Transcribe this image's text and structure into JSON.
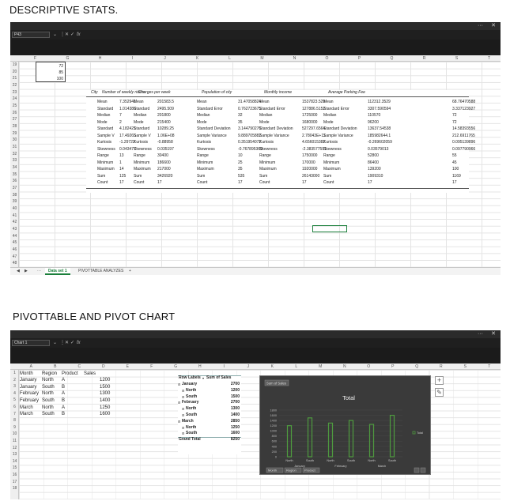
{
  "headings": {
    "top": "DESCRIPTIVE STATS.",
    "bottom": "PIVOTTABLE AND PIVOT CHART"
  },
  "window1": {
    "namebox": "P43",
    "fx": "fx",
    "columns": [
      "F",
      "G",
      "H",
      "I",
      "J",
      "K",
      "L",
      "M",
      "N",
      "O",
      "P",
      "Q",
      "R",
      "S",
      "T"
    ],
    "rows": [
      "19",
      "20",
      "21",
      "22",
      "23",
      "24",
      "25",
      "26",
      "27",
      "28",
      "29",
      "30",
      "31",
      "32",
      "33",
      "34",
      "35",
      "36",
      "37",
      "38",
      "39",
      "40",
      "41",
      "42",
      "43",
      "44",
      "45",
      "46",
      "47",
      "48"
    ],
    "top_values": [
      "72",
      "85",
      "100"
    ],
    "groups": [
      {
        "header": "City",
        "labels": [],
        "values": []
      },
      {
        "header": "Number of weekly riders",
        "labels": [
          "Mean",
          "Standard",
          "Median",
          "Mode",
          "Standard",
          "Sample V",
          "Kurtosis",
          "Skewness",
          "Range",
          "Minimum",
          "Maximum",
          "Sum",
          "Count"
        ],
        "values": [
          "7.352941",
          "1.014386",
          "7",
          "2",
          "4.182421",
          "17.49265",
          "-1.29722",
          "0.043477",
          "13",
          "1",
          "14",
          "125",
          "17"
        ]
      },
      {
        "header": "Charges per week",
        "labels": [
          "Mean",
          "Standard",
          "Median",
          "Mode",
          "Standard",
          "Sample V",
          "Kurtosis",
          "Skewness",
          "Range",
          "Minimum",
          "Maximum",
          "Sum",
          "Count"
        ],
        "values": [
          "201583.5",
          "2495.509",
          "201800",
          "215400",
          "10289.25",
          "1.06E+08",
          "-0.88958",
          "0.035197",
          "30400",
          "186600",
          "217000",
          "3426920",
          "17"
        ]
      },
      {
        "header": "Population of city",
        "labels": [
          "Mean",
          "Standard Error",
          "Median",
          "Mode",
          "Standard Deviation",
          "Sample Variance",
          "Kurtosis",
          "Skewness",
          "Range",
          "Minimum",
          "Maximum",
          "Sum",
          "Count"
        ],
        "values": [
          "31.47058824",
          "0.762723675",
          "32",
          "35",
          "3.144790276",
          "9.889705882",
          "0.351954072",
          "-0.767895369",
          "10",
          "25",
          "35",
          "535",
          "17"
        ]
      },
      {
        "header": "Monthly income",
        "labels": [
          "Mean",
          "Standard Error",
          "Median",
          "Mode",
          "Standard Deviation",
          "Sample Variance",
          "Kurtosis",
          "Skewness",
          "Range",
          "Minimum",
          "Maximum",
          "Sum",
          "Count"
        ],
        "values": [
          "1537823.529",
          "127886.5152",
          "1725000",
          "1680000",
          "527297.6564",
          "2.78043E+11",
          "4.656015382",
          "-2.383577591",
          "1750000",
          "170000",
          "1920000",
          "26143000",
          "17"
        ]
      },
      {
        "header": "Average Parking Fee",
        "labels": [
          "Mean",
          "Standard Error",
          "Median",
          "Mode",
          "Standard Deviation",
          "Sample Variance",
          "Kurtosis",
          "Skewness",
          "Range",
          "Minimum",
          "Maximum",
          "Sum",
          "Count"
        ],
        "values": [
          "112312.3529",
          "3307.590594",
          "110570",
          "96200",
          "13637.54538",
          "185982644.1",
          "-0.269602059",
          "0.03579013",
          "52800",
          "86400",
          "139200",
          "1909310",
          "17"
        ]
      },
      {
        "header": "",
        "labels": [],
        "values": [
          "68.76470588",
          "3.337123927",
          "72",
          "72",
          "14.58393556",
          "212.6911765",
          "0.095139896",
          "0.097790966",
          "55",
          "45",
          "100",
          "1169",
          "17"
        ]
      }
    ],
    "tabs": [
      "Data set 1",
      "PIVOTTABLE ANALYZES"
    ],
    "tab_add": "+"
  },
  "window2": {
    "namebox": "Chart 1",
    "fx": "fx",
    "columns": [
      "A",
      "B",
      "C",
      "D",
      "E",
      "F",
      "G",
      "H",
      "I",
      "J",
      "K",
      "L",
      "M",
      "N",
      "O",
      "P",
      "Q",
      "R",
      "S",
      "T"
    ],
    "rows": [
      "1",
      "2",
      "3",
      "4",
      "5",
      "6",
      "7",
      "8",
      "9",
      "10",
      "11",
      "12",
      "13",
      "14",
      "15",
      "16",
      "17",
      "18"
    ],
    "source": {
      "headers": [
        "Month",
        "Region",
        "Product",
        "Sales"
      ],
      "rows": [
        [
          "January",
          "North",
          "A",
          "1200"
        ],
        [
          "January",
          "South",
          "B",
          "1500"
        ],
        [
          "February",
          "North",
          "A",
          "1300"
        ],
        [
          "February",
          "South",
          "B",
          "1400"
        ],
        [
          "March",
          "North",
          "A",
          "1250"
        ],
        [
          "March",
          "South",
          "B",
          "1600"
        ]
      ]
    },
    "pivot": {
      "header_labels": "Row Labels",
      "header_sum": "Sum of Sales",
      "rows": [
        {
          "label": "January",
          "value": "2700",
          "level": 0
        },
        {
          "label": "North",
          "value": "1200",
          "level": 1
        },
        {
          "label": "South",
          "value": "1500",
          "level": 1
        },
        {
          "label": "February",
          "value": "2700",
          "level": 0
        },
        {
          "label": "North",
          "value": "1300",
          "level": 1
        },
        {
          "label": "South",
          "value": "1400",
          "level": 1
        },
        {
          "label": "March",
          "value": "2850",
          "level": 0
        },
        {
          "label": "North",
          "value": "1250",
          "level": 1
        },
        {
          "label": "South",
          "value": "1600",
          "level": 1
        }
      ],
      "grand_label": "Grand Total",
      "grand_value": "8250"
    },
    "field_buttons": [
      "Month",
      "Region",
      "Product"
    ]
  },
  "chart_data": {
    "type": "bar",
    "title": "Total",
    "field_label": "Sum of Sales",
    "legend": "Total",
    "categories": [
      "North",
      "South",
      "North",
      "South",
      "North",
      "South"
    ],
    "groups": [
      "January",
      "February",
      "March"
    ],
    "series": [
      {
        "name": "Total",
        "values": [
          1200,
          1500,
          1300,
          1400,
          1250,
          1600
        ]
      }
    ],
    "yticks": [
      "1800",
      "1600",
      "1400",
      "1200",
      "1000",
      "800",
      "600",
      "400",
      "200",
      "0"
    ],
    "ylim": [
      0,
      1800
    ],
    "colors": {
      "bar": "#4e9a3f",
      "bg": "#3a3a3a"
    }
  }
}
